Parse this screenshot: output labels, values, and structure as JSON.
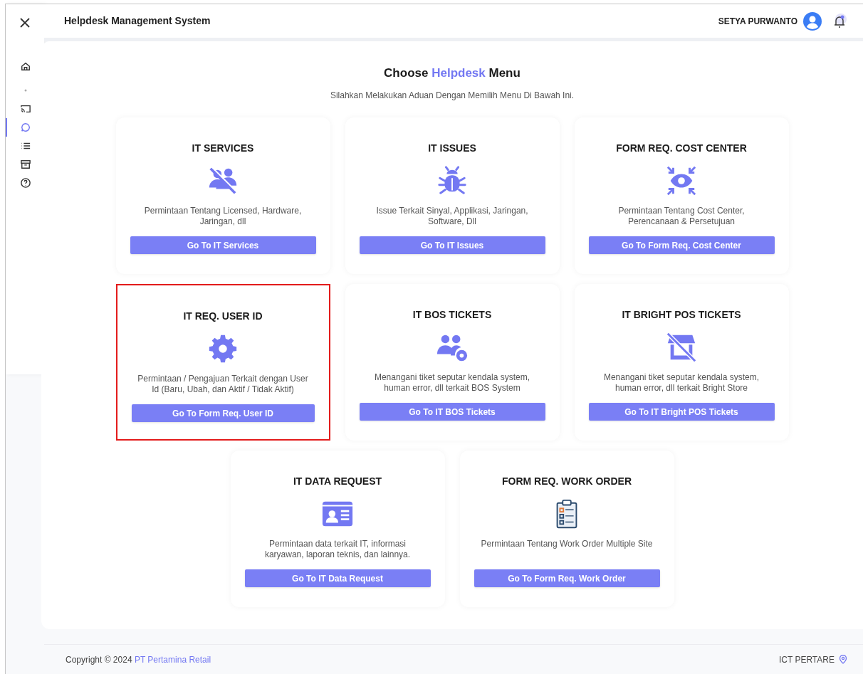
{
  "sidebar": {
    "items": [
      {
        "selected": false
      },
      {
        "selected": false
      },
      {
        "selected": false
      },
      {
        "selected": true
      },
      {
        "selected": false
      },
      {
        "selected": false
      },
      {
        "selected": false
      }
    ]
  },
  "header": {
    "title": "Helpdesk Management System",
    "user_name": "SETYA PURWANTO",
    "notification_unread": true
  },
  "heading": {
    "start": "Choose",
    "highlight": "Helpdesk",
    "end": "Menu"
  },
  "subtitle": "Silahkan Melakukan Aduan Dengan Memilih Menu Di Bawah Ini.",
  "cards": [
    {
      "title": "IT SERVICES",
      "description": "Permintaan Tentang Licensed, Hardware, Jaringan, dll",
      "button": "Go To IT Services",
      "highlighted": false
    },
    {
      "title": "IT ISSUES",
      "description": "Issue Terkait Sinyal, Applikasi, Jaringan, Software, Dll",
      "button": "Go To IT Issues",
      "highlighted": false
    },
    {
      "title": "FORM REQ. COST CENTER",
      "description": "Permintaan Tentang Cost Center, Perencanaan & Persetujuan",
      "button": "Go To Form Req. Cost Center",
      "highlighted": false
    },
    {
      "title": "IT REQ. USER ID",
      "description": "Permintaan / Pengajuan Terkait dengan User Id (Baru, Ubah, dan Aktif / Tidak Aktif)",
      "button": "Go To Form Req. User ID",
      "highlighted": true
    },
    {
      "title": "IT BOS TICKETS",
      "description": "Menangani tiket seputar kendala system, human error, dll terkait BOS System",
      "button": "Go To IT BOS Tickets",
      "highlighted": false
    },
    {
      "title": "IT BRIGHT POS TICKETS",
      "description": "Menangani tiket seputar kendala system, human error, dll terkait Bright Store",
      "button": "Go To IT Bright POS Tickets",
      "highlighted": false
    },
    {
      "title": "IT DATA REQUEST",
      "description": "Permintaan data terkait IT, informasi karyawan, laporan teknis, dan lainnya.",
      "button": "Go To IT Data Request",
      "highlighted": false
    },
    {
      "title": "FORM REQ. WORK ORDER",
      "description": "Permintaan Tentang Work Order Multiple Site",
      "button": "Go To Form Req. Work Order",
      "highlighted": false
    }
  ],
  "footer": {
    "copyright": "Copyright © 2024",
    "company_link": "PT Pertamina Retail",
    "right_label": "ICT PERTARE"
  }
}
